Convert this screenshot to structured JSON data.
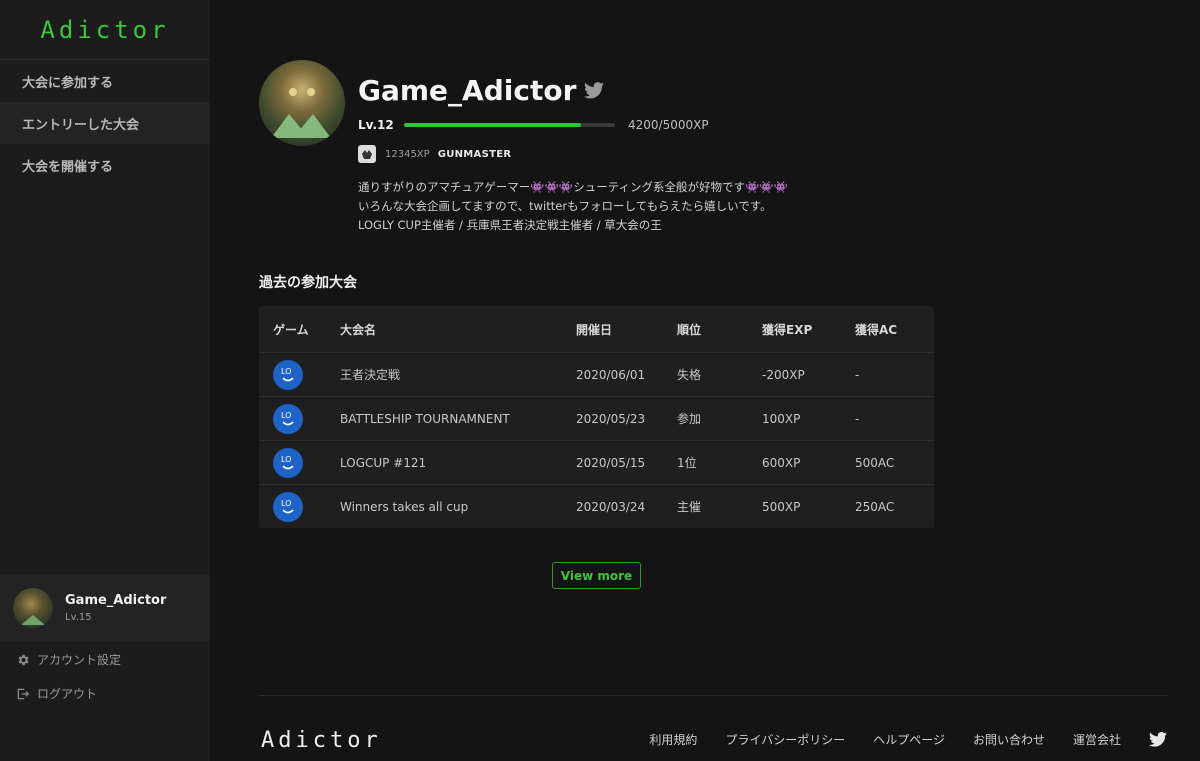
{
  "brand": {
    "logo": "Adictor",
    "accent": "#3ec43e"
  },
  "sidebar": {
    "items": [
      {
        "label": "大会に参加する"
      },
      {
        "label": "エントリーした大会"
      },
      {
        "label": "大会を開催する"
      }
    ],
    "user": {
      "name": "Game_Adictor",
      "level": "Lv.15"
    },
    "account_settings": "アカウント設定",
    "logout": "ログアウト"
  },
  "profile": {
    "username": "Game_Adictor",
    "level": "Lv.12",
    "xp_text": "4200/5000XP",
    "xp_progress": 0.84,
    "badge": {
      "xp": "12345XP",
      "title": "GUNMASTER"
    },
    "bio": [
      "通りすがりのアマチュアゲーマー👾👾👾シューティング系全般が好物です👾👾👾",
      "いろんな大会企画してますので、twitterもフォローしてもらえたら嬉しいです。",
      "LOGLY CUP主催者 / 兵庫県王者決定戦主催者 / 草大会の王"
    ]
  },
  "history": {
    "title": "過去の参加大会",
    "headers": {
      "game": "ゲーム",
      "name": "大会名",
      "date": "開催日",
      "rank": "順位",
      "exp": "獲得EXP",
      "ac": "獲得AC"
    },
    "rows": [
      {
        "name": "王者決定戦",
        "date": "2020/06/01",
        "rank": "失格",
        "exp": "-200XP",
        "ac": "-"
      },
      {
        "name": "BATTLESHIP TOURNAMNENT",
        "date": "2020/05/23",
        "rank": "参加",
        "exp": "100XP",
        "ac": "-"
      },
      {
        "name": "LOGCUP #121",
        "date": "2020/05/15",
        "rank": "1位",
        "exp": "600XP",
        "ac": "500AC"
      },
      {
        "name": "Winners takes all cup",
        "date": "2020/03/24",
        "rank": "主催",
        "exp": "500XP",
        "ac": "250AC"
      }
    ],
    "view_more": "View more"
  },
  "footer": {
    "logo": "Adictor",
    "links": [
      "利用規約",
      "プライバシーポリシー",
      "ヘルプページ",
      "お問い合わせ",
      "運営会社"
    ]
  }
}
